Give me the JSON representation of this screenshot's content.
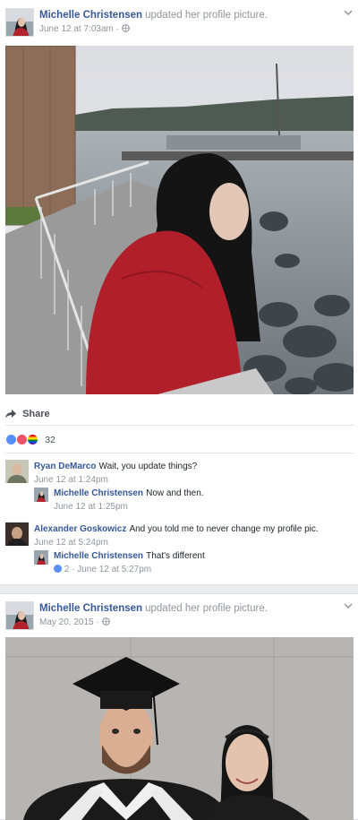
{
  "posts": [
    {
      "author": "Michelle Christensen",
      "action": "updated her profile picture.",
      "date": "June 12 at 7:03am",
      "privacy_icon": "globe-icon",
      "share_label": "Share",
      "reaction_icons": [
        "like-icon",
        "love-icon",
        "pride-icon"
      ],
      "reaction_count": "32",
      "comments": [
        {
          "author": "Ryan DeMarco",
          "text": "Wait, you update things?",
          "time": "June 12 at 1:24pm",
          "reply": {
            "author": "Michelle Christensen",
            "text": "Now and then.",
            "time": "June 12 at 1:25pm"
          }
        },
        {
          "author": "Alexander Goskowicz",
          "text": "And you told me to never change my profile pic.",
          "time": "June 12 at 5:24pm",
          "reply": {
            "author": "Michelle Christensen",
            "text": "That's different",
            "likes": "2",
            "separator": "·",
            "time": "June 12 at 5:27pm"
          }
        }
      ]
    },
    {
      "author": "Michelle Christensen",
      "action": "updated her profile picture.",
      "date": "May 20, 2015",
      "privacy_icon": "globe-icon"
    }
  ],
  "colors": {
    "link": "#365899",
    "meta": "#90949c",
    "like": "#5890ff",
    "love": "#f25268",
    "background": "#e9ebee"
  }
}
